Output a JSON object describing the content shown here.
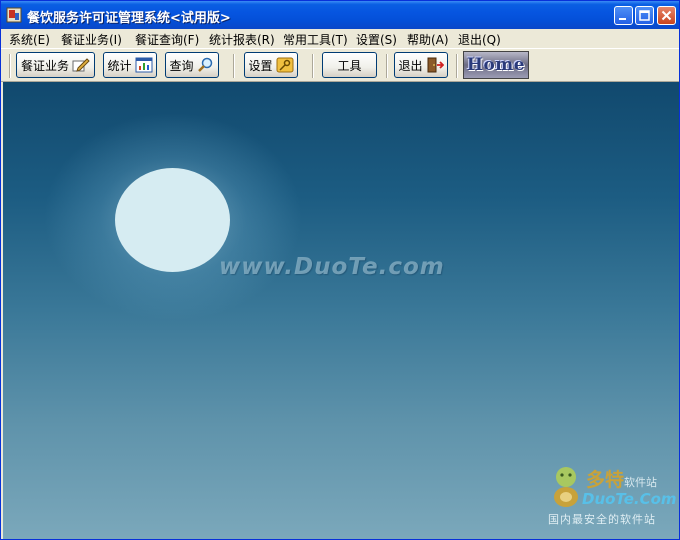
{
  "window": {
    "title": "餐饮服务许可证管理系统<试用版>"
  },
  "menu": {
    "items": [
      "系统(E)",
      "餐证业务(I)",
      "餐证查询(F)",
      "统计报表(R)",
      "常用工具(T)",
      "设置(S)",
      "帮助(A)",
      "退出(Q)"
    ]
  },
  "toolbar": {
    "business_label": "餐证业务",
    "stats_label": "统计",
    "query_label": "查询",
    "settings_label": "设置",
    "tools_label": "工具",
    "exit_label": "退出",
    "home_label": "Home"
  },
  "content": {
    "watermark_url": "www.DuoTe.com",
    "logo_cn": "多特",
    "logo_cn_small": "软件站",
    "logo_en": "DuoTe.Com",
    "logo_tagline": "国内最安全的软件站"
  },
  "colors": {
    "titlebar": "#0655e0",
    "sky_top": "#11496e",
    "sky_bottom": "#7ba8bb",
    "moon": "#d6ecf2"
  }
}
